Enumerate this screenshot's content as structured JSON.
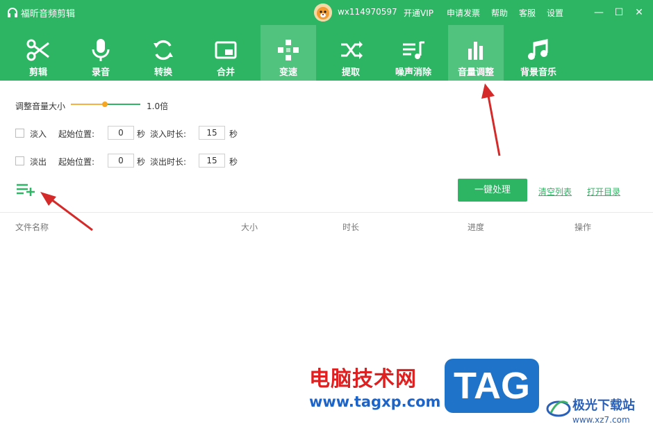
{
  "app": {
    "title": "福昕音频剪辑"
  },
  "user": {
    "name": "wx114970597"
  },
  "top_menu": [
    "开通VIP",
    "申请发票",
    "帮助",
    "客服",
    "设置"
  ],
  "window_controls": {
    "minimize": "—",
    "maximize": "☐",
    "close": "✕"
  },
  "tools": [
    {
      "label": "剪辑",
      "icon": "scissors-icon"
    },
    {
      "label": "录音",
      "icon": "microphone-icon"
    },
    {
      "label": "转换",
      "icon": "refresh-icon"
    },
    {
      "label": "合并",
      "icon": "merge-icon"
    },
    {
      "label": "变速",
      "icon": "gamepad-icon"
    },
    {
      "label": "提取",
      "icon": "shuffle-icon"
    },
    {
      "label": "噪声消除",
      "icon": "playlist-music-icon"
    },
    {
      "label": "音量调整",
      "icon": "bar-chart-icon"
    },
    {
      "label": "背景音乐",
      "icon": "music-note-icon"
    }
  ],
  "active_tool": "音量调整",
  "volume": {
    "label": "调整音量大小",
    "value_text": "1.0倍",
    "slider_fraction": 0.49,
    "color_left": "#f5b041",
    "color_right": "#2db563"
  },
  "fade_in": {
    "label": "淡入",
    "start_label": "起始位置:",
    "start_value": "0",
    "sec1": "秒",
    "duration_label": "淡入时长:",
    "duration_value": "15",
    "sec2": "秒"
  },
  "fade_out": {
    "label": "淡出",
    "start_label": "起始位置:",
    "start_value": "0",
    "sec1": "秒",
    "duration_label": "淡出时长:",
    "duration_value": "15",
    "sec2": "秒"
  },
  "actions": {
    "process": "一键处理",
    "clear": "清空列表",
    "open_dir": "打开目录"
  },
  "table": {
    "columns": [
      "文件名称",
      "大小",
      "时长",
      "进度",
      "操作"
    ]
  },
  "watermark": {
    "cn": "电脑技术网",
    "url": "www.tagxp.com",
    "tag": "TAG",
    "site": "极光下载站",
    "site_url": "www.xz7.com"
  },
  "colors": {
    "brand": "#2db563",
    "arrow": "#d42a2a"
  }
}
